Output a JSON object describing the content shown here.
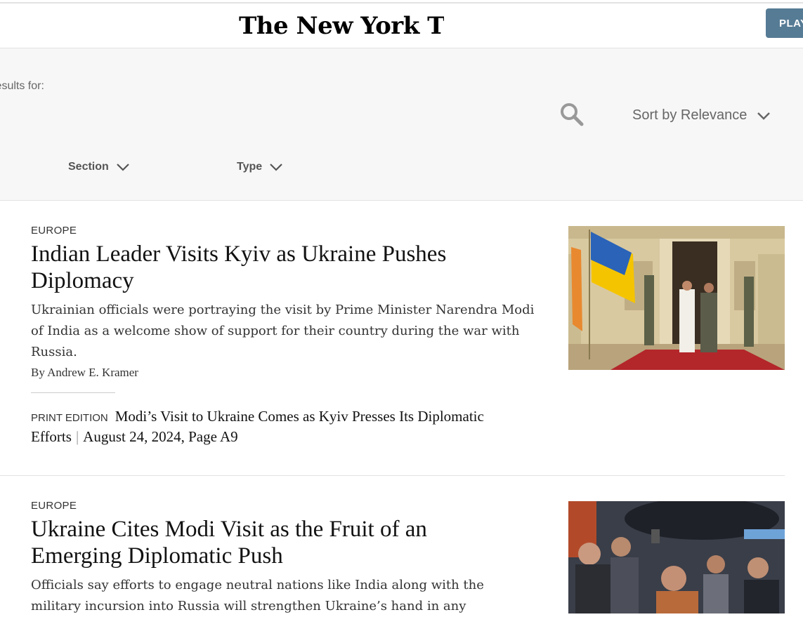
{
  "masthead": {
    "logo": "The New York Times",
    "play_button": "PLAY"
  },
  "search": {
    "results_label": "Results for:",
    "sort_label": "Sort by Relevance",
    "filters": {
      "section": "Section",
      "type": "Type"
    }
  },
  "articles": [
    {
      "kicker": "EUROPE",
      "headline": "Indian Leader Visits Kyiv as Ukraine Pushes Diplomacy",
      "summary": "Ukrainian officials were portraying the visit by Prime Minister Narendra Modi of India as a welcome show of support for their country during the war with Russia.",
      "byline": "By Andrew E. Kramer",
      "print_label": "PRINT EDITION",
      "print_headline": "Modi’s Visit to Ukraine Comes as Kyiv Presses Its Diplomatic Efforts",
      "print_date": "August 24, 2024, Page A9"
    },
    {
      "kicker": "EUROPE",
      "headline": "Ukraine Cites Modi Visit as the Fruit of an Emerging Diplomatic Push",
      "summary": "Officials say efforts to engage neutral nations like India along with the military incursion into Russia will strengthen Ukraine’s hand in any"
    }
  ],
  "colors": {
    "play_button": "#567b95",
    "panel_bg": "#f7f7f7",
    "text": "#121212"
  }
}
